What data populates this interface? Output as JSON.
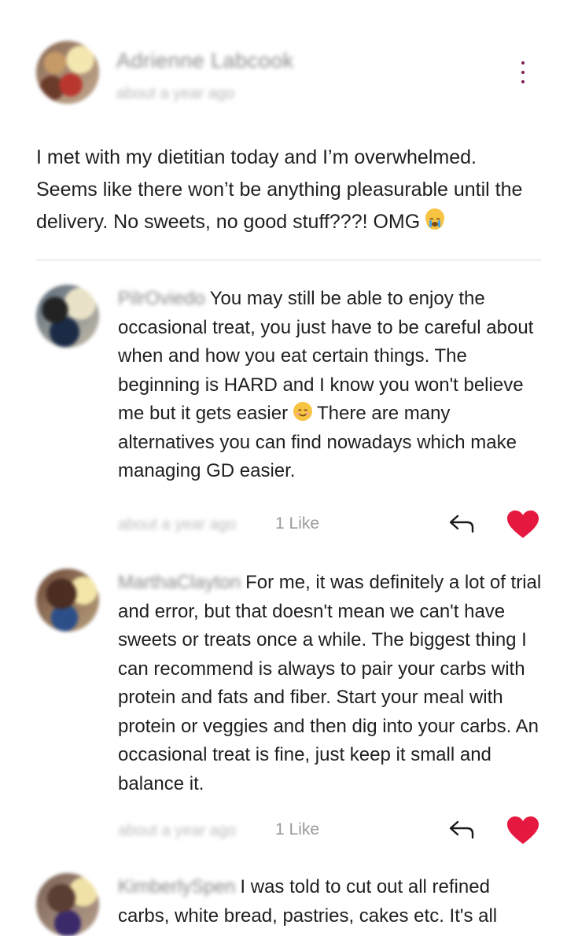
{
  "post": {
    "author": "Adrienne Labcook",
    "time": "about a year ago",
    "body": "I met with my dietitian today and I’m overwhelmed. Seems like there won’t be anything pleasurable until the delivery. No sweets, no good stuff???! OMG",
    "emoji": "loudly-crying-face-emoji"
  },
  "comments": [
    {
      "author": "PilrOviedo",
      "text_a": "You may still be able to enjoy the occasional treat, you just have to be careful about when and how you eat certain things. The beginning is HARD and I know you won't believe me but it gets easier",
      "text_b": " There are many alternatives you can find nowadays which make managing GD easier.",
      "time": "about a year ago",
      "likes": "1 Like"
    },
    {
      "author": "MarthaClayton",
      "text_a": "For me, it was definitely a lot of trial and error, but that doesn't mean we can't have sweets or treats once a while. The biggest thing I can recommend is always to pair your carbs with protein and fats and fiber. Start your meal with protein or veggies and then dig into your carbs. An occasional treat is fine, just keep it small and balance it.",
      "text_b": "",
      "time": "about a year ago",
      "likes": "1 Like"
    },
    {
      "author": "KimberlySpen",
      "text_a": "I was told to cut out all refined carbs, white bread, pastries, cakes etc. It's all",
      "text_b": "",
      "time": "",
      "likes": ""
    }
  ],
  "icons": {
    "more": "more-vertical-icon",
    "reply": "reply-icon",
    "like": "heart-icon"
  },
  "colors": {
    "accent_heart": "#e5193f",
    "kebab": "#7a1f55",
    "divider": "#d8d8d8"
  }
}
